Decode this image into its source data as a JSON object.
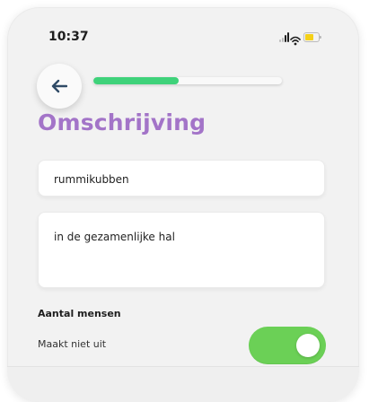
{
  "status_bar": {
    "time": "10:37",
    "icons": [
      "signal-icon",
      "wifi-icon",
      "battery-icon"
    ],
    "battery_color": "#f4d018"
  },
  "header": {
    "back_icon": "arrow-left-icon",
    "progress_fraction": 0.45,
    "progress_color": "#3fd27a"
  },
  "page": {
    "title": "Omschrijving",
    "title_color": "#a374c8"
  },
  "form": {
    "name_value": "rummikubben",
    "description_value": "in de gezamenlijke hal",
    "people_section_label": "Aantal mensen",
    "people_toggle_label": "Maakt niet uit",
    "people_toggle_on": true,
    "toggle_color": "#6bd056"
  }
}
